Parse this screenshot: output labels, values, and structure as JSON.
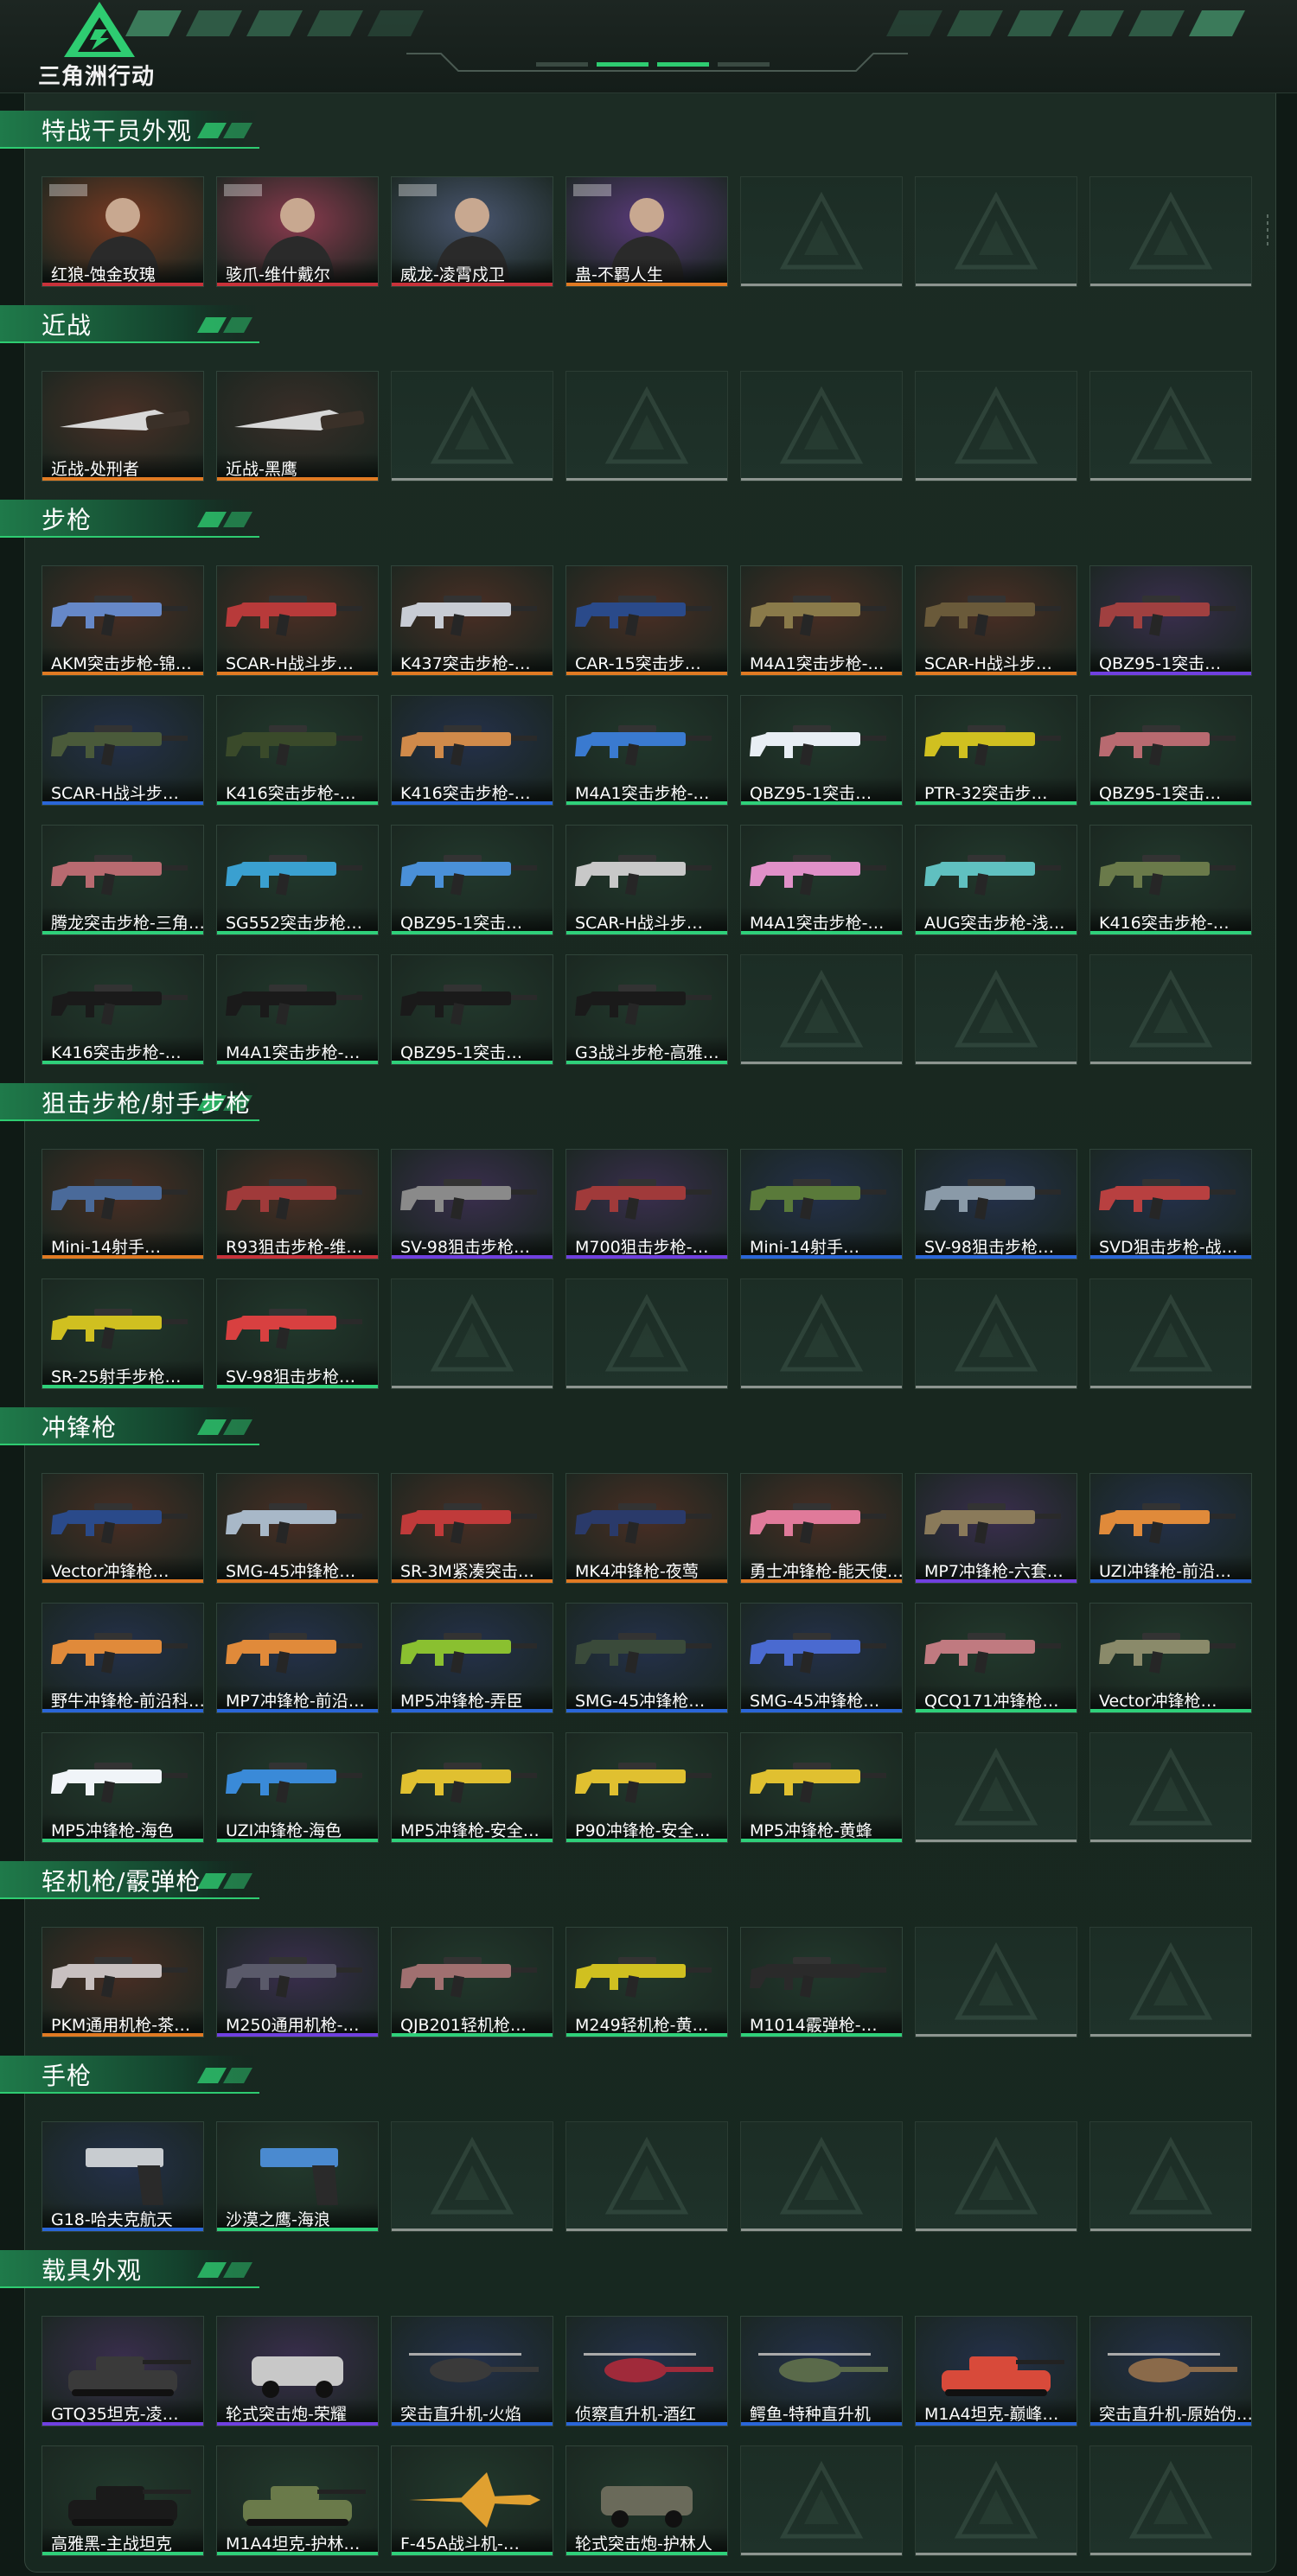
{
  "app": {
    "logo_text": "三角洲行动"
  },
  "colors": {
    "orange": "#e07a23",
    "red": "#c8323a",
    "purple": "#7040e0",
    "blue": "#2a66d8",
    "green": "#2fd07a",
    "accent": "#2ecc71"
  },
  "sections": [
    {
      "title": "特战干员外观",
      "slots": 7,
      "items": [
        {
          "name": "红狼-蚀金玫瑰",
          "rarity": "red",
          "kind": "operator",
          "tint": "#7a3a22"
        },
        {
          "name": "骇爪-维什戴尔",
          "rarity": "red",
          "kind": "operator",
          "tint": "#8a3a4e"
        },
        {
          "name": "威龙-凌霄戍卫",
          "rarity": "red",
          "kind": "operator",
          "tint": "#4a5670"
        },
        {
          "name": "蛊-不羁人生",
          "rarity": "orange",
          "kind": "operator",
          "tint": "#5a3a7a"
        }
      ]
    },
    {
      "title": "近战",
      "slots": 7,
      "items": [
        {
          "name": "近战-处刑者",
          "rarity": "orange",
          "kind": "knife",
          "tint": "#4a3026"
        },
        {
          "name": "近战-黑鹰",
          "rarity": "orange",
          "kind": "knife",
          "tint": "#3a2e28"
        }
      ]
    },
    {
      "title": "步枪",
      "slots": 28,
      "items": [
        {
          "name": "AKM突击步枪-锦…",
          "rarity": "orange",
          "kind": "gun",
          "tint": "#4a2e24",
          "gun": "#6688c8"
        },
        {
          "name": "SCAR-H战斗步…",
          "rarity": "orange",
          "kind": "gun",
          "tint": "#4a2e24",
          "gun": "#b83a3a"
        },
        {
          "name": "K437突击步枪-…",
          "rarity": "orange",
          "kind": "gun",
          "tint": "#4a2e24",
          "gun": "#c8ccd4"
        },
        {
          "name": "CAR-15突击步…",
          "rarity": "orange",
          "kind": "gun",
          "tint": "#4a2e24",
          "gun": "#2a4a8a"
        },
        {
          "name": "M4A1突击步枪-…",
          "rarity": "orange",
          "kind": "gun",
          "tint": "#4a2e24",
          "gun": "#8a7a4a"
        },
        {
          "name": "SCAR-H战斗步…",
          "rarity": "orange",
          "kind": "gun",
          "tint": "#4a2e24",
          "gun": "#6a5a3a"
        },
        {
          "name": "QBZ95-1突击…",
          "rarity": "purple",
          "kind": "gun",
          "tint": "#3a2e4e",
          "gun": "#a04040"
        },
        {
          "name": "SCAR-H战斗步…",
          "rarity": "blue",
          "kind": "gun",
          "tint": "#24304a",
          "gun": "#4a5a3a"
        },
        {
          "name": "K416突击步枪-…",
          "rarity": "green",
          "kind": "gun",
          "tint": "#22382c",
          "gun": "#3a4a2a"
        },
        {
          "name": "K416突击步枪-…",
          "rarity": "blue",
          "kind": "gun",
          "tint": "#24304a",
          "gun": "#d08a4a"
        },
        {
          "name": "M4A1突击步枪-…",
          "rarity": "green",
          "kind": "gun",
          "tint": "#22382c",
          "gun": "#3a7ad0"
        },
        {
          "name": "QBZ95-1突击…",
          "rarity": "green",
          "kind": "gun",
          "tint": "#22382c",
          "gun": "#e8eef4"
        },
        {
          "name": "PTR-32突击步…",
          "rarity": "green",
          "kind": "gun",
          "tint": "#22382c",
          "gun": "#d0c020"
        },
        {
          "name": "QBZ95-1突击…",
          "rarity": "green",
          "kind": "gun",
          "tint": "#22382c",
          "gun": "#b86a70"
        },
        {
          "name": "腾龙突击步枪-三角…",
          "rarity": "green",
          "kind": "gun",
          "tint": "#22382c",
          "gun": "#b86a70"
        },
        {
          "name": "SG552突击步枪…",
          "rarity": "green",
          "kind": "gun",
          "tint": "#22382c",
          "gun": "#3aa0d0"
        },
        {
          "name": "QBZ95-1突击…",
          "rarity": "green",
          "kind": "gun",
          "tint": "#22382c",
          "gun": "#4a90d8"
        },
        {
          "name": "SCAR-H战斗步…",
          "rarity": "green",
          "kind": "gun",
          "tint": "#22382c",
          "gun": "#c8c8c8"
        },
        {
          "name": "M4A1突击步枪-…",
          "rarity": "green",
          "kind": "gun",
          "tint": "#22382c",
          "gun": "#e090c8"
        },
        {
          "name": "AUG突击步枪-浅…",
          "rarity": "green",
          "kind": "gun",
          "tint": "#22382c",
          "gun": "#60c0c0"
        },
        {
          "name": "K416突击步枪-…",
          "rarity": "green",
          "kind": "gun",
          "tint": "#22382c",
          "gun": "#6a7a4a"
        },
        {
          "name": "K416突击步枪-…",
          "rarity": "green",
          "kind": "gun",
          "tint": "#22382c",
          "gun": "#1a1a1a"
        },
        {
          "name": "M4A1突击步枪-…",
          "rarity": "green",
          "kind": "gun",
          "tint": "#22382c",
          "gun": "#1a1a1a"
        },
        {
          "name": "QBZ95-1突击…",
          "rarity": "green",
          "kind": "gun",
          "tint": "#22382c",
          "gun": "#1a1a1a"
        },
        {
          "name": "G3战斗步枪-高雅…",
          "rarity": "green",
          "kind": "gun",
          "tint": "#22382c",
          "gun": "#1a1a1a"
        }
      ]
    },
    {
      "title": "狙击步枪/射手步枪",
      "slots": 14,
      "items": [
        {
          "name": "Mini-14射手…",
          "rarity": "orange",
          "kind": "gun",
          "tint": "#4a2e24",
          "gun": "#4a6a9a"
        },
        {
          "name": "R93狙击步枪-维…",
          "rarity": "red",
          "kind": "gun",
          "tint": "#4a2e24",
          "gun": "#a03a3a"
        },
        {
          "name": "SV-98狙击步枪…",
          "rarity": "purple",
          "kind": "gun",
          "tint": "#3a2e4e",
          "gun": "#8a8a8a"
        },
        {
          "name": "M700狙击步枪-…",
          "rarity": "purple",
          "kind": "gun",
          "tint": "#3a2e4e",
          "gun": "#a03a3a"
        },
        {
          "name": "Mini-14射手…",
          "rarity": "blue",
          "kind": "gun",
          "tint": "#24304a",
          "gun": "#5a7a3a"
        },
        {
          "name": "SV-98狙击步枪…",
          "rarity": "blue",
          "kind": "gun",
          "tint": "#24304a",
          "gun": "#8a9aa8"
        },
        {
          "name": "SVD狙击步枪-战…",
          "rarity": "blue",
          "kind": "gun",
          "tint": "#24304a",
          "gun": "#b84040"
        },
        {
          "name": "SR-25射手步枪…",
          "rarity": "green",
          "kind": "gun",
          "tint": "#22382c",
          "gun": "#d0c020"
        },
        {
          "name": "SV-98狙击步枪…",
          "rarity": "green",
          "kind": "gun",
          "tint": "#22382c",
          "gun": "#d84040"
        }
      ]
    },
    {
      "title": "冲锋枪",
      "slots": 21,
      "items": [
        {
          "name": "Vector冲锋枪…",
          "rarity": "orange",
          "kind": "gun",
          "tint": "#4a2e24",
          "gun": "#2a4a8a"
        },
        {
          "name": "SMG-45冲锋枪…",
          "rarity": "orange",
          "kind": "gun",
          "tint": "#4a2e24",
          "gun": "#a8b8c8"
        },
        {
          "name": "SR-3M紧凑突击…",
          "rarity": "orange",
          "kind": "gun",
          "tint": "#4a2e24",
          "gun": "#c03a3a"
        },
        {
          "name": "MK4冲锋枪-夜莺",
          "rarity": "orange",
          "kind": "gun",
          "tint": "#4a2e24",
          "gun": "#2a3a6a"
        },
        {
          "name": "勇士冲锋枪-能天使…",
          "rarity": "orange",
          "kind": "gun",
          "tint": "#4a2e24",
          "gun": "#e07a9a"
        },
        {
          "name": "MP7冲锋枪-六套…",
          "rarity": "purple",
          "kind": "gun",
          "tint": "#3a2e4e",
          "gun": "#8a7a5a"
        },
        {
          "name": "UZI冲锋枪-前沿…",
          "rarity": "blue",
          "kind": "gun",
          "tint": "#24304a",
          "gun": "#e08a3a"
        },
        {
          "name": "野牛冲锋枪-前沿科…",
          "rarity": "blue",
          "kind": "gun",
          "tint": "#24304a",
          "gun": "#e08a3a"
        },
        {
          "name": "MP7冲锋枪-前沿…",
          "rarity": "blue",
          "kind": "gun",
          "tint": "#24304a",
          "gun": "#e08a3a"
        },
        {
          "name": "MP5冲锋枪-弄臣",
          "rarity": "blue",
          "kind": "gun",
          "tint": "#24304a",
          "gun": "#8ac030"
        },
        {
          "name": "SMG-45冲锋枪…",
          "rarity": "blue",
          "kind": "gun",
          "tint": "#24304a",
          "gun": "#3a4a3a"
        },
        {
          "name": "SMG-45冲锋枪…",
          "rarity": "blue",
          "kind": "gun",
          "tint": "#24304a",
          "gun": "#4a6ad0"
        },
        {
          "name": "QCQ171冲锋枪…",
          "rarity": "green",
          "kind": "gun",
          "tint": "#22382c",
          "gun": "#c07a80"
        },
        {
          "name": "Vector冲锋枪…",
          "rarity": "green",
          "kind": "gun",
          "tint": "#22382c",
          "gun": "#8a8a6a"
        },
        {
          "name": "MP5冲锋枪-海色",
          "rarity": "green",
          "kind": "gun",
          "tint": "#22382c",
          "gun": "#f0f4f8"
        },
        {
          "name": "UZI冲锋枪-海色",
          "rarity": "green",
          "kind": "gun",
          "tint": "#22382c",
          "gun": "#3a8ad8"
        },
        {
          "name": "MP5冲锋枪-安全…",
          "rarity": "green",
          "kind": "gun",
          "tint": "#22382c",
          "gun": "#e0c030"
        },
        {
          "name": "P90冲锋枪-安全…",
          "rarity": "green",
          "kind": "gun",
          "tint": "#22382c",
          "gun": "#e0c030"
        },
        {
          "name": "MP5冲锋枪-黄蜂",
          "rarity": "green",
          "kind": "gun",
          "tint": "#22382c",
          "gun": "#e0c030"
        }
      ]
    },
    {
      "title": "轻机枪/霰弹枪",
      "slots": 7,
      "items": [
        {
          "name": "PKM通用机枪-茶…",
          "rarity": "orange",
          "kind": "gun",
          "tint": "#4a2e24",
          "gun": "#c8c0c0"
        },
        {
          "name": "M250通用机枪-…",
          "rarity": "purple",
          "kind": "gun",
          "tint": "#3a2e4e",
          "gun": "#5a5a6a"
        },
        {
          "name": "QJB201轻机枪…",
          "rarity": "green",
          "kind": "gun",
          "tint": "#22382c",
          "gun": "#a07070"
        },
        {
          "name": "M249轻机枪-黄…",
          "rarity": "green",
          "kind": "gun",
          "tint": "#22382c",
          "gun": "#d0c020"
        },
        {
          "name": "M1014霰弹枪-…",
          "rarity": "green",
          "kind": "gun",
          "tint": "#22382c",
          "gun": "#2a2a2a"
        }
      ]
    },
    {
      "title": "手枪",
      "slots": 7,
      "items": [
        {
          "name": "G18-哈夫克航天",
          "rarity": "blue",
          "kind": "pistol",
          "tint": "#24304a",
          "gun": "#c8ccd0"
        },
        {
          "name": "沙漠之鹰-海浪",
          "rarity": "green",
          "kind": "pistol",
          "tint": "#22382c",
          "gun": "#4a8ad0"
        }
      ]
    },
    {
      "title": "载具外观",
      "slots": 14,
      "items": [
        {
          "name": "GTQ35坦克-凌…",
          "rarity": "purple",
          "kind": "tank",
          "tint": "#3a2e4e",
          "gun": "#3a3a3a"
        },
        {
          "name": "轮式突击炮-荣耀",
          "rarity": "purple",
          "kind": "car",
          "tint": "#3a2e4e",
          "gun": "#c8c8c8"
        },
        {
          "name": "突击直升机-火焰",
          "rarity": "blue",
          "kind": "heli",
          "tint": "#24304a",
          "gun": "#3a3a3a"
        },
        {
          "name": "侦察直升机-酒红",
          "rarity": "blue",
          "kind": "heli",
          "tint": "#24304a",
          "gun": "#a02a3a"
        },
        {
          "name": "鳄鱼-特种直升机",
          "rarity": "blue",
          "kind": "heli",
          "tint": "#24304a",
          "gun": "#5a6a4a"
        },
        {
          "name": "M1A4坦克-巅峰…",
          "rarity": "blue",
          "kind": "tank",
          "tint": "#24304a",
          "gun": "#d84a3a"
        },
        {
          "name": "突击直升机-原始伪…",
          "rarity": "blue",
          "kind": "heli",
          "tint": "#24304a",
          "gun": "#8a6a4a"
        },
        {
          "name": "高雅黑-主战坦克",
          "rarity": "green",
          "kind": "tank",
          "tint": "#22382c",
          "gun": "#1a1a1a"
        },
        {
          "name": "M1A4坦克-护林…",
          "rarity": "green",
          "kind": "tank",
          "tint": "#22382c",
          "gun": "#6a7a4a"
        },
        {
          "name": "F-45A战斗机-…",
          "rarity": "green",
          "kind": "jet",
          "tint": "#22382c",
          "gun": "#e0a030"
        },
        {
          "name": "轮式突击炮-护林人",
          "rarity": "green",
          "kind": "car",
          "tint": "#22382c",
          "gun": "#6a6a5a"
        }
      ]
    }
  ]
}
